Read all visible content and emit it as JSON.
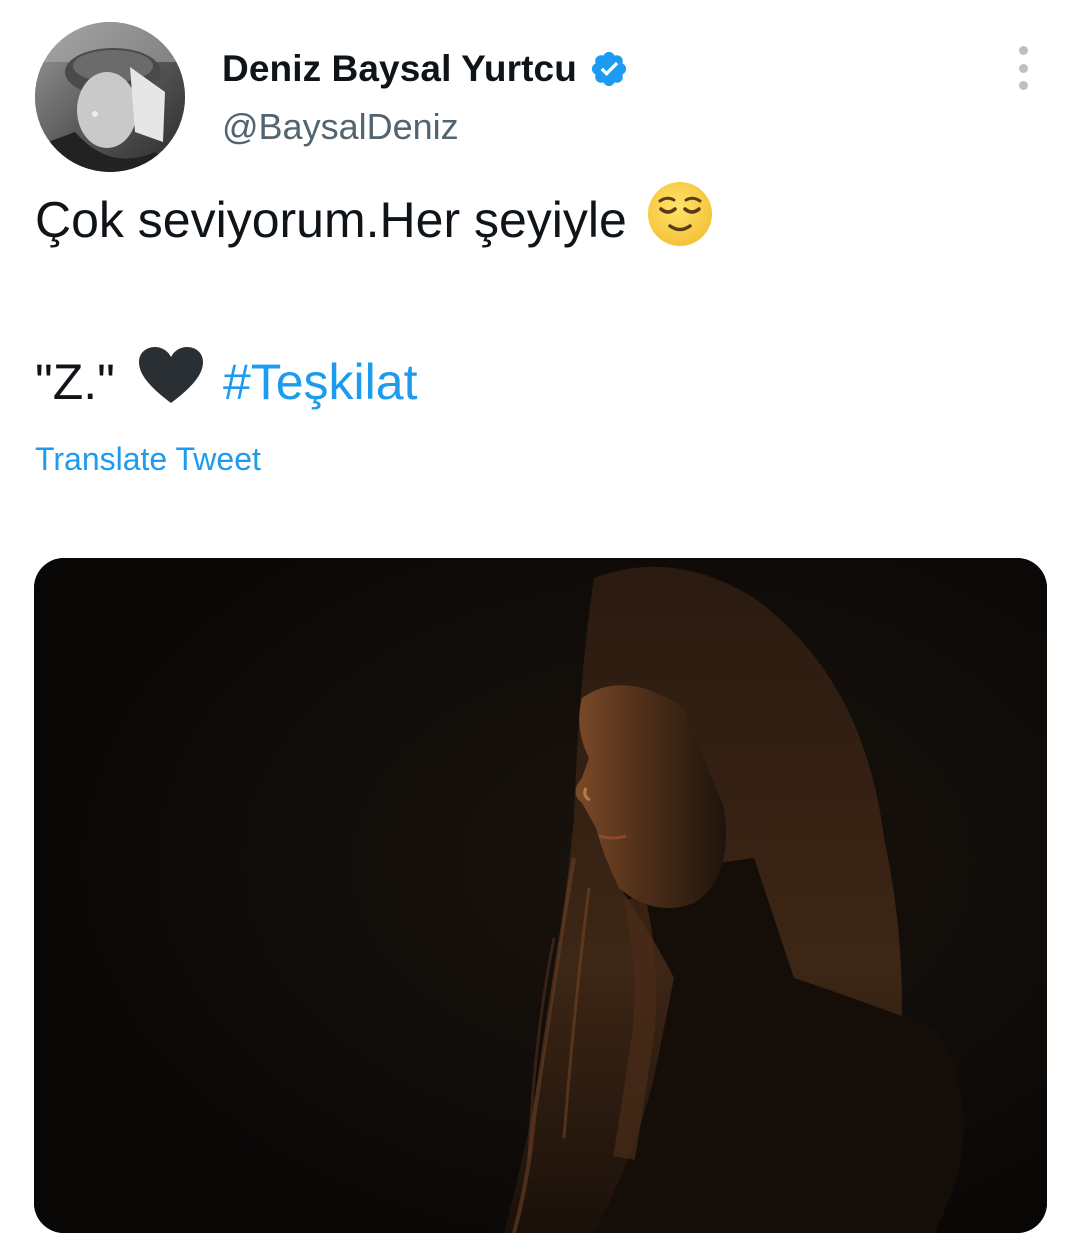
{
  "author": {
    "display_name": "Deniz Baysal Yurtcu",
    "handle": "@BaysalDeniz",
    "verified": true,
    "avatar": "profile-photo",
    "verified_color": "#1d9bf0"
  },
  "menu": {
    "icon": "more-vertical-icon"
  },
  "tweet": {
    "line1_text": "Çok seviyorum.Her şeyiyle",
    "line1_emoji": "relieved-face-emoji",
    "line2_text": "\"Z.\"",
    "line2_emoji": "black-heart-emoji",
    "hashtag": "#Teşkilat",
    "hashtag_color": "#1d9bf0"
  },
  "translate": {
    "label": "Translate Tweet"
  },
  "media": {
    "type": "photo",
    "description_icon": "tweet-photo"
  },
  "colors": {
    "text": "#0f1419",
    "secondary": "#536471",
    "link": "#1d9bf0"
  }
}
